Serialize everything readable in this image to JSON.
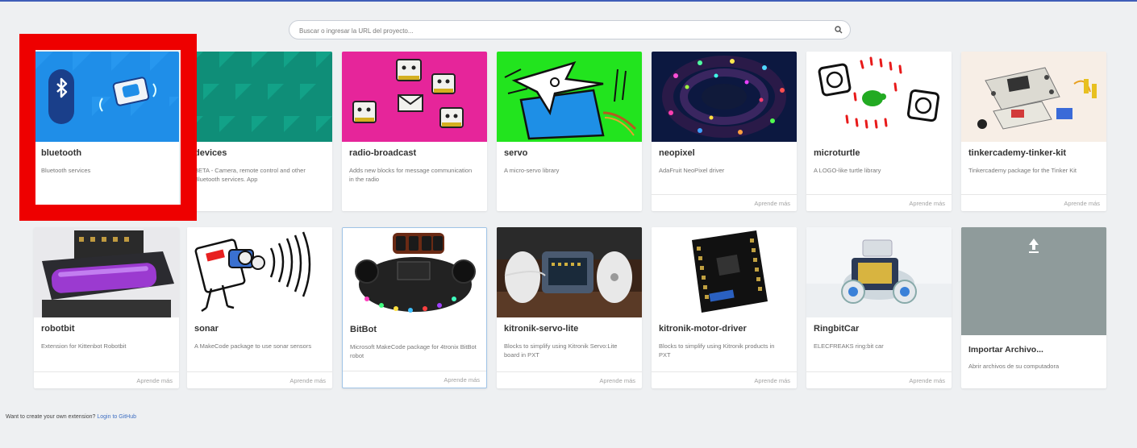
{
  "search": {
    "placeholder": "Buscar o ingresar la URL del proyecto..."
  },
  "cards_row1": [
    {
      "title": "bluetooth",
      "desc": "Bluetooth services",
      "learn": ""
    },
    {
      "title": "devices",
      "desc": "BETA - Camera, remote control and other Bluetooth services. App",
      "learn": ""
    },
    {
      "title": "radio-broadcast",
      "desc": "Adds new blocks for message communication in the radio",
      "learn": ""
    },
    {
      "title": "servo",
      "desc": "A micro-servo library",
      "learn": ""
    },
    {
      "title": "neopixel",
      "desc": "AdaFruit NeoPixel driver",
      "learn": "Aprende más"
    },
    {
      "title": "microturtle",
      "desc": "A LOGO-like turtle library",
      "learn": "Aprende más"
    },
    {
      "title": "tinkercademy-tinker-kit",
      "desc": "Tinkercademy package for the Tinker Kit",
      "learn": "Aprende más"
    }
  ],
  "cards_row2": [
    {
      "title": "robotbit",
      "desc": "Extension for Kittenbot Robotbit",
      "learn": "Aprende más"
    },
    {
      "title": "sonar",
      "desc": "A MakeCode package to use sonar sensors",
      "learn": "Aprende más"
    },
    {
      "title": "BitBot",
      "desc": "Microsoft MakeCode package for 4tronix BitBot robot",
      "learn": "Aprende más"
    },
    {
      "title": "kitronik-servo-lite",
      "desc": "Blocks to simplify using Kitronik Servo:Lite board in PXT",
      "learn": "Aprende más"
    },
    {
      "title": "kitronik-motor-driver",
      "desc": "Blocks to simplify using Kitronik products in PXT",
      "learn": "Aprende más"
    },
    {
      "title": "RingbitCar",
      "desc": "ELECFREAKS ring:bit car",
      "learn": "Aprende más"
    }
  ],
  "import_card": {
    "title": "Importar Archivo...",
    "desc": "Abrir archivos de su computadora"
  },
  "footer": {
    "text": "Want to create your own extension?",
    "link": "Login to GitHub"
  }
}
